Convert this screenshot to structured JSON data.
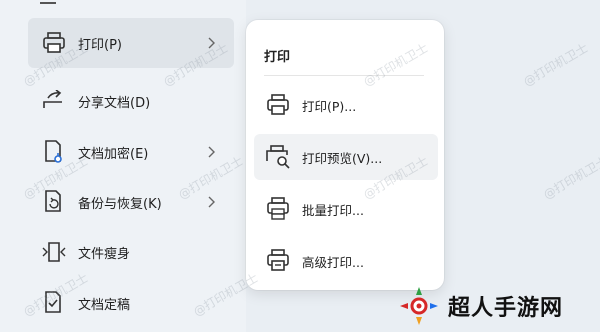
{
  "menu": {
    "items": [
      {
        "label": "打印(P)",
        "icon": "printer-icon",
        "has_submenu": true
      },
      {
        "label": "分享文档(D)",
        "icon": "share-icon",
        "has_submenu": false
      },
      {
        "label": "文档加密(E)",
        "icon": "document-lock-icon",
        "has_submenu": true
      },
      {
        "label": "备份与恢复(K)",
        "icon": "backup-icon",
        "has_submenu": true
      },
      {
        "label": "文件瘦身",
        "icon": "file-slim-icon",
        "has_submenu": false
      },
      {
        "label": "文档定稿",
        "icon": "document-finalize-icon",
        "has_submenu": false
      }
    ]
  },
  "submenu": {
    "title": "打印",
    "items": [
      {
        "label": "打印(P)...",
        "icon": "printer-icon"
      },
      {
        "label": "打印预览(V)...",
        "icon": "print-preview-icon"
      },
      {
        "label": "批量打印...",
        "icon": "batch-print-icon"
      },
      {
        "label": "高级打印...",
        "icon": "advanced-print-icon"
      }
    ]
  },
  "watermark_text": "@打印机卫士",
  "logo": {
    "text": "超人手游网"
  },
  "colors": {
    "accent_active": "#dfe4e9",
    "popup_bg": "#ffffff",
    "background": "#e9eef3"
  }
}
